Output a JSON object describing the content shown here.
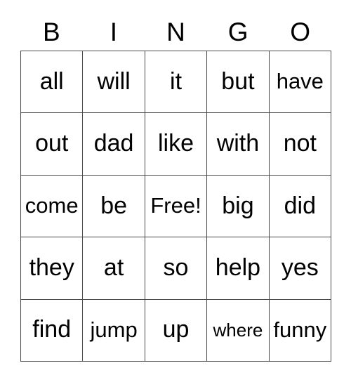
{
  "card": {
    "header_letters": [
      "B",
      "I",
      "N",
      "G",
      "O"
    ],
    "colors": {
      "background": "#ffffff",
      "grid_line": "#4a4a4a",
      "text": "#000000"
    },
    "rows": [
      [
        {
          "label": "all",
          "size": "normal",
          "free": false
        },
        {
          "label": "will",
          "size": "normal",
          "free": false
        },
        {
          "label": "it",
          "size": "normal",
          "free": false
        },
        {
          "label": "but",
          "size": "normal",
          "free": false
        },
        {
          "label": "have",
          "size": "medium",
          "free": false
        }
      ],
      [
        {
          "label": "out",
          "size": "normal",
          "free": false
        },
        {
          "label": "dad",
          "size": "normal",
          "free": false
        },
        {
          "label": "like",
          "size": "normal",
          "free": false
        },
        {
          "label": "with",
          "size": "normal",
          "free": false
        },
        {
          "label": "not",
          "size": "normal",
          "free": false
        }
      ],
      [
        {
          "label": "come",
          "size": "medium",
          "free": false
        },
        {
          "label": "be",
          "size": "normal",
          "free": false
        },
        {
          "label": "Free!",
          "size": "medium",
          "free": true
        },
        {
          "label": "big",
          "size": "normal",
          "free": false
        },
        {
          "label": "did",
          "size": "normal",
          "free": false
        }
      ],
      [
        {
          "label": "they",
          "size": "normal",
          "free": false
        },
        {
          "label": "at",
          "size": "normal",
          "free": false
        },
        {
          "label": "so",
          "size": "normal",
          "free": false
        },
        {
          "label": "help",
          "size": "normal",
          "free": false
        },
        {
          "label": "yes",
          "size": "normal",
          "free": false
        }
      ],
      [
        {
          "label": "find",
          "size": "normal",
          "free": false
        },
        {
          "label": "jump",
          "size": "medium",
          "free": false
        },
        {
          "label": "up",
          "size": "normal",
          "free": false
        },
        {
          "label": "where",
          "size": "small",
          "free": false
        },
        {
          "label": "funny",
          "size": "medium",
          "free": false
        }
      ]
    ]
  }
}
